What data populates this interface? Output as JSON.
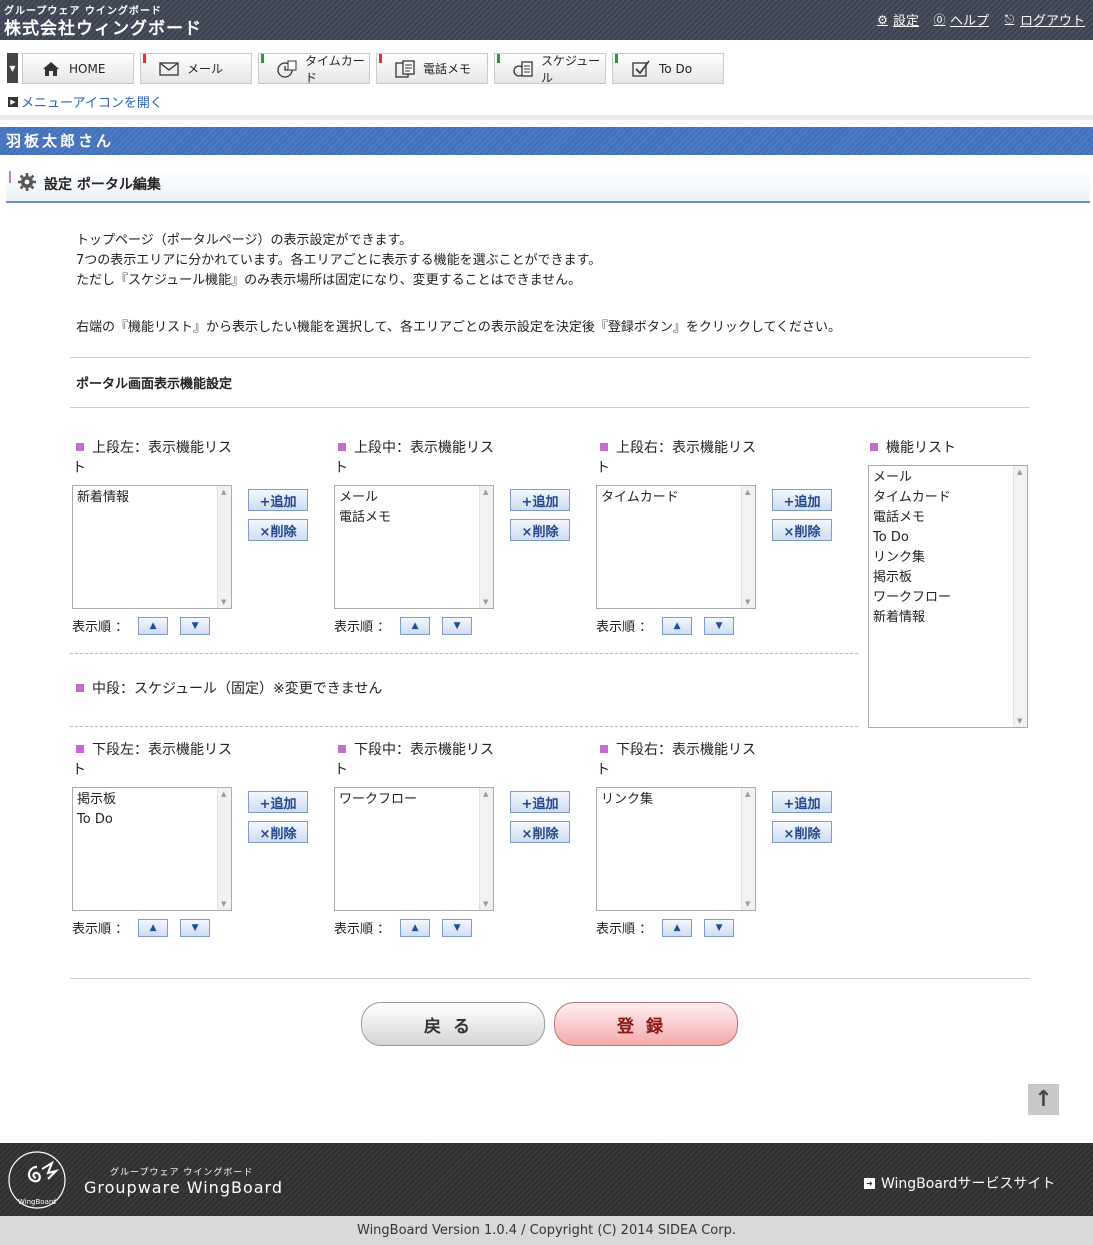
{
  "header": {
    "brand_sub": "グループウェア ウイングボード",
    "brand_main": "株式会社ウィングボード",
    "links": {
      "settings": "設定",
      "help": "ヘルプ",
      "logout": "ログアウト"
    }
  },
  "toolbar": {
    "home": "HOME",
    "mail": "メール",
    "timecard": "タイムカード",
    "phone_memo": "電話メモ",
    "schedule": "スケジュール",
    "todo": "To Do",
    "menu_open": "メニューアイコンを開く"
  },
  "user": {
    "name": "羽板太郎さん"
  },
  "section": {
    "title": "設定 ポータル編集"
  },
  "description": {
    "line1": "トップページ（ポータルページ）の表示設定ができます。",
    "line2": "7つの表示エリアに分かれています。各エリアごとに表示する機能を選ぶことができます。",
    "line3": "ただし『スケジュール機能』のみ表示場所は固定になり、変更することはできません。",
    "line4": "右端の『機能リスト』から表示したい機能を選択して、各エリアごとの表示設定を決定後『登録ボタン』をクリックしてください。"
  },
  "portal_settings": {
    "heading": "ポータル画面表示機能設定",
    "add_label": "+追加",
    "delete_label": "×削除",
    "order_label": "表示順 ：",
    "up_arrow": "▲",
    "down_arrow": "▼",
    "areas": {
      "upper_left": {
        "label": "上段左：表示機能リスト",
        "items": [
          "新着情報"
        ]
      },
      "upper_center": {
        "label": "上段中：表示機能リスト",
        "items": [
          "メール",
          "電話メモ"
        ]
      },
      "upper_right": {
        "label": "上段右：表示機能リスト",
        "items": [
          "タイムカード"
        ]
      },
      "lower_left": {
        "label": "下段左：表示機能リスト",
        "items": [
          "掲示板",
          "To Do"
        ]
      },
      "lower_center": {
        "label": "下段中：表示機能リスト",
        "items": [
          "ワークフロー"
        ]
      },
      "lower_right": {
        "label": "下段右：表示機能リスト",
        "items": [
          "リンク集"
        ]
      }
    },
    "middle_note": "中段：スケジュール（固定）※変更できません",
    "function_list": {
      "label": "機能リスト",
      "items": [
        "メール",
        "タイムカード",
        "電話メモ",
        "To Do",
        "リンク集",
        "掲示板",
        "ワークフロー",
        "新着情報"
      ]
    }
  },
  "buttons": {
    "back": "戻る",
    "submit": "登録",
    "scroll_top": "↑"
  },
  "footer": {
    "sub": "グループウェア ウイングボード",
    "main": "Groupware WingBoard",
    "service_link": "WingBoardサービスサイト",
    "copyright": "WingBoard Version 1.0.4 / Copyright (C) 2014 SIDEA Corp.",
    "logo_text": "WingBoard"
  },
  "colors": {
    "header_bg": "#3c4150",
    "user_bar": "#4a78c0",
    "marker": "#c86ad4",
    "submit": "#f4a9a9"
  }
}
